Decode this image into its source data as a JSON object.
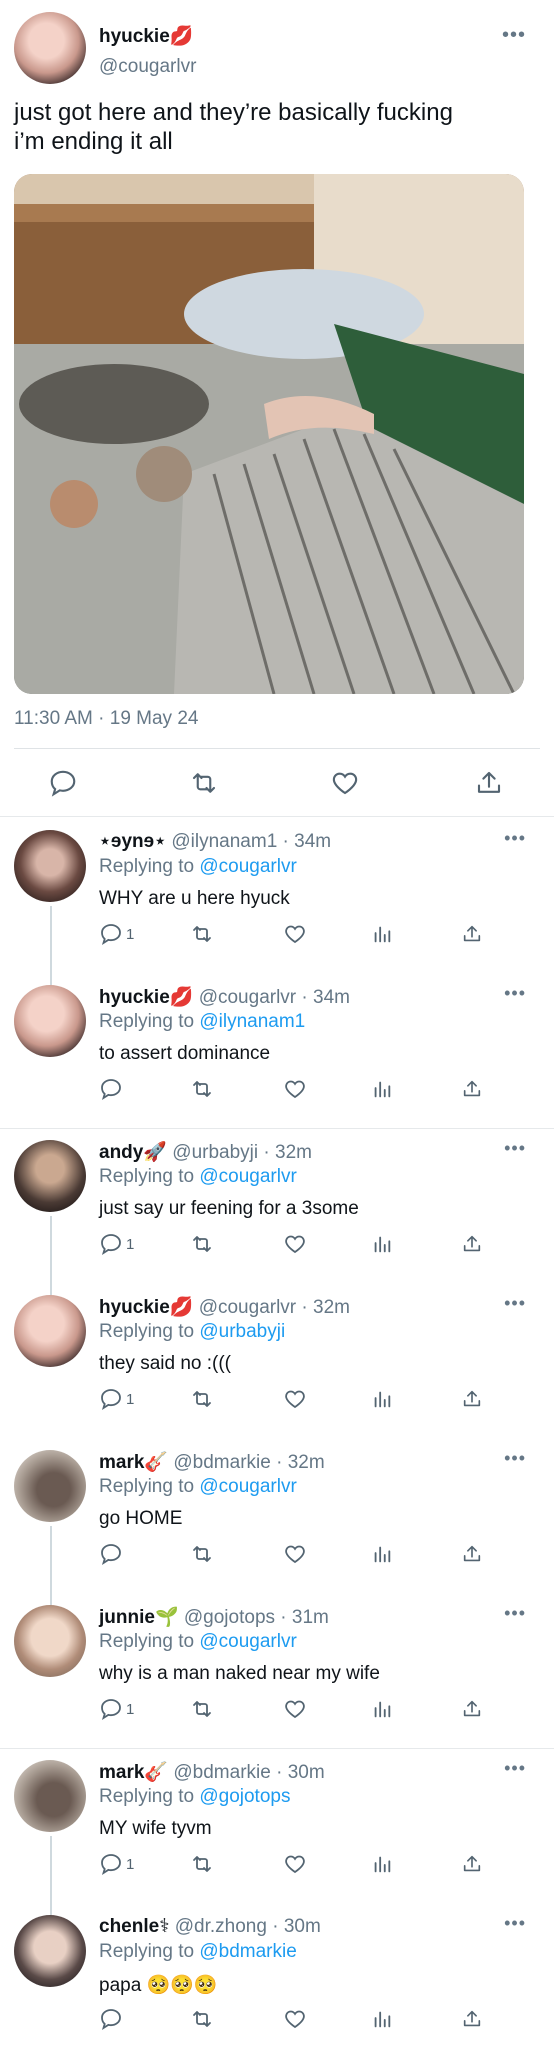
{
  "tweet": {
    "author_name": "hyuckie💋",
    "author_handle": "@cougarlvr",
    "text": "just got here and they’re basically fucking\ni’m ending it all",
    "timestamp": "11:30 AM · 19 May 24",
    "more": "•••"
  },
  "colors": {
    "accent": "#1d9bf0",
    "muted": "#657786",
    "text": "#0f1419"
  },
  "replies": [
    {
      "name": "⋆ɘynɘ⋆",
      "meta": "@ilynanam1 · 34m",
      "replying_label": "Replying to ",
      "replying_to": "@cougarlvr",
      "text": "WHY are u here hyuck",
      "reply_count": "1",
      "more": "•••"
    },
    {
      "name": "hyuckie💋",
      "meta": "@cougarlvr · 34m",
      "replying_label": "Replying to ",
      "replying_to": "@ilynanam1",
      "text": "to assert dominance",
      "reply_count": "",
      "more": "•••"
    },
    {
      "name": "andy🚀",
      "meta": "@urbabyji · 32m",
      "replying_label": "Replying to ",
      "replying_to": "@cougarlvr",
      "text": "just say ur feening for a 3some",
      "reply_count": "1",
      "more": "•••"
    },
    {
      "name": "hyuckie💋",
      "meta": "@cougarlvr · 32m",
      "replying_label": "Replying to ",
      "replying_to": "@urbabyji",
      "text": "they said no :(((",
      "reply_count": "1",
      "more": "•••"
    },
    {
      "name": "mark🎸",
      "meta": "@bdmarkie · 32m",
      "replying_label": "Replying to ",
      "replying_to": "@cougarlvr",
      "text": "go HOME",
      "reply_count": "",
      "more": "•••"
    },
    {
      "name": "junnie🌱",
      "meta": "@gojotops · 31m",
      "replying_label": "Replying to ",
      "replying_to": "@cougarlvr",
      "text": "why is a man naked near my wife",
      "reply_count": "1",
      "more": "•••"
    },
    {
      "name": "mark🎸",
      "meta": "@bdmarkie · 30m",
      "replying_label": "Replying to ",
      "replying_to": "@gojotops",
      "text": "MY wife tyvm",
      "reply_count": "1",
      "more": "•••"
    },
    {
      "name": "chenle⚕",
      "meta": "@dr.zhong · 30m",
      "replying_label": "Replying to ",
      "replying_to": "@bdmarkie",
      "text": "papa 🥺🥺🥺",
      "reply_count": "",
      "more": "•••"
    }
  ],
  "icons": {
    "reply": "reply-icon",
    "retweet": "retweet-icon",
    "like": "like-icon",
    "views": "views-icon",
    "share": "share-icon"
  }
}
